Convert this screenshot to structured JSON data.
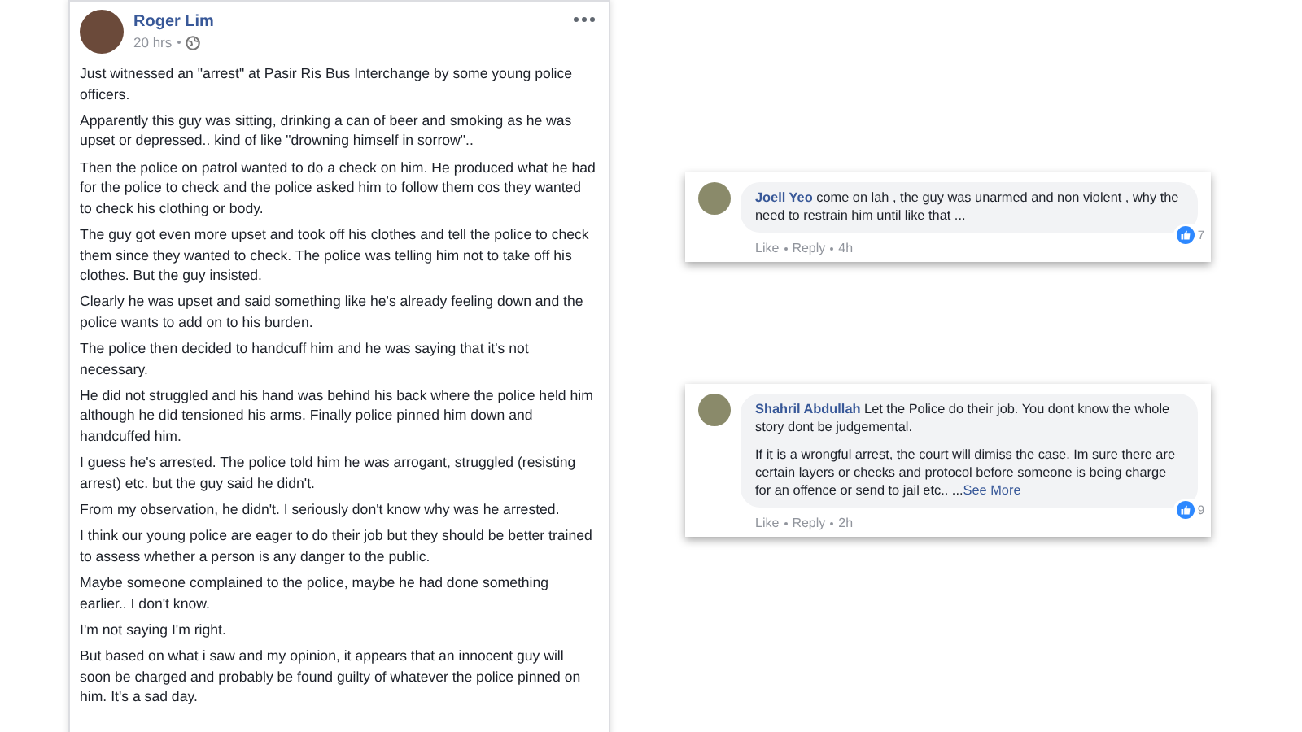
{
  "post": {
    "author": "Roger Lim",
    "time": "20 hrs",
    "paragraphs": [
      "Just witnessed an \"arrest\" at Pasir Ris Bus Interchange by some young police officers.",
      "Apparently this guy was sitting, drinking a can of beer and smoking as he was upset or depressed.. kind of like \"drowning himself in sorrow\"..",
      "Then the police on patrol wanted to do a check on him. He produced what he had for the police to check and the police asked him to follow them cos they wanted to check his clothing or body.",
      "The guy got even more upset and took off his clothes and tell the police to check them since they wanted to check. The police was telling him not to take off his clothes. But the guy insisted.",
      "Clearly he was upset and said something like he's already feeling down and the police wants to add on to his burden.",
      "The police then decided to handcuff him and he was saying that it's not necessary.",
      "He did not struggled and his hand was behind his back where the police held him although he did tensioned his arms. Finally police pinned him down and handcuffed him.",
      "I guess he's arrested. The police told him he was arrogant, struggled (resisting arrest) etc. but the guy said he didn't.",
      "From my observation, he didn't. I seriously don't know why was he arrested.",
      "I think our young police are eager to do their job but they should be better trained to assess whether a person is any danger to the public.",
      "Maybe someone complained to the police, maybe he had done something earlier.. I don't know.",
      "I'm not saying I'm right.",
      "But based on what i saw and my opinion, it appears that an innocent guy will soon be charged and probably be found guilty of whatever the police pinned on him. It's a sad day."
    ]
  },
  "comments": [
    {
      "author": "Joell Yeo",
      "paragraphs": [
        "come on lah , the guy was unarmed and non violent , why the need to restrain him until like that ..."
      ],
      "actions": [
        "Like",
        "Reply",
        "4h"
      ],
      "reactions": "7"
    },
    {
      "author": "Shahril Abdullah",
      "paragraphs": [
        "Let the Police do their job. You dont know the whole story dont be judgemental.",
        "If it is a wrongful arrest, the court will dimiss the case. Im sure there are certain layers or checks and protocol before someone is being charge for an offence or send to jail etc.. ..."
      ],
      "see_more": "See More",
      "actions": [
        "Like",
        "Reply",
        "2h"
      ],
      "reactions": "9"
    }
  ]
}
